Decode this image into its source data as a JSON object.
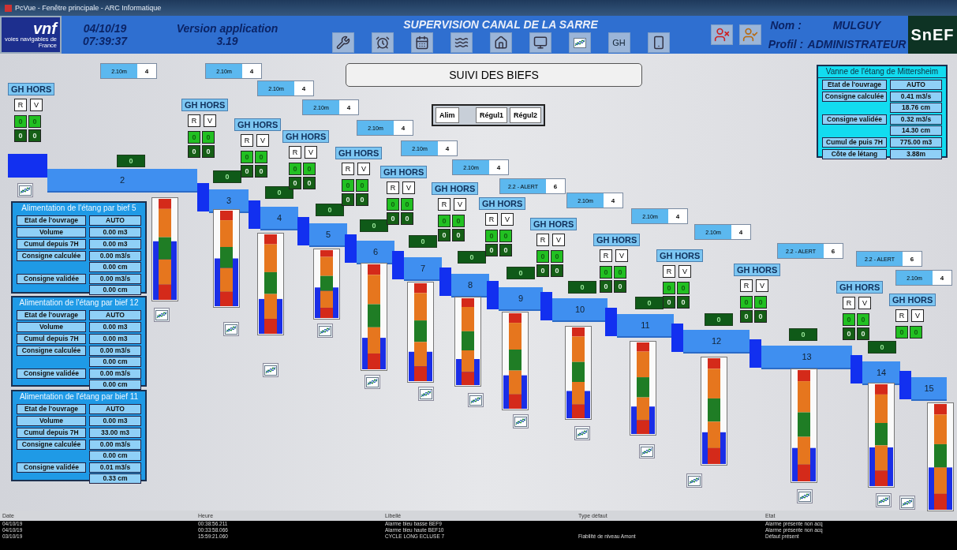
{
  "window": {
    "title": "PcVue - Fenêtre principale - ARC Informatique"
  },
  "header": {
    "logo_text": "vnf",
    "logo_subtitle": "voies navigables de France",
    "date": "04/10/19",
    "time": "07:39:37",
    "version_label": "Version application",
    "version": "3.19",
    "title": "SUPERVISION CANAL DE LA SARRE",
    "gh_button": "GH",
    "user_name_label": "Nom :",
    "user_name": "MULGUY",
    "profile_label": "Profil :",
    "profile": "ADMINISTRATEUR",
    "company_logo": "SnEF"
  },
  "synoptic": {
    "title": "SUIVI DES BIEFS",
    "mode_buttons": [
      "Alim",
      "Régul1",
      "Régul2"
    ],
    "level_indicators": [
      {
        "value": "2.10m",
        "count": "4"
      },
      {
        "value": "2.10m",
        "count": "4"
      },
      {
        "value": "2.10m",
        "count": "4"
      },
      {
        "value": "2.10m",
        "count": "4"
      },
      {
        "value": "2.10m",
        "count": "4"
      },
      {
        "value": "2.10m",
        "count": "4"
      },
      {
        "value": "2.10m",
        "count": "4"
      },
      {
        "value": "2.2 - ALERT",
        "count": "6"
      },
      {
        "value": "2.10m",
        "count": "4"
      },
      {
        "value": "2.10m",
        "count": "4"
      },
      {
        "value": "2.10m",
        "count": "4"
      },
      {
        "value": "2.2 - ALERT",
        "count": "6"
      },
      {
        "value": "2.2 - ALERT",
        "count": "6"
      },
      {
        "value": "2.10m",
        "count": "4"
      }
    ],
    "gate_panels": [
      {
        "status": "GH HORS",
        "buttons": [
          "R",
          "V"
        ],
        "counters": [
          "0",
          "0",
          "0",
          "0"
        ]
      },
      {
        "status": "GH HORS",
        "buttons": [
          "R",
          "V"
        ],
        "counters": [
          "0",
          "0",
          "0",
          "0"
        ]
      },
      {
        "status": "GH HORS",
        "buttons": [
          "R",
          "V"
        ],
        "counters": [
          "0",
          "0",
          "0",
          "0"
        ]
      },
      {
        "status": "GH HORS",
        "buttons": [
          "R",
          "V"
        ],
        "counters": [
          "0",
          "0",
          "0",
          "0"
        ]
      },
      {
        "status": "GH HORS",
        "buttons": [
          "R",
          "V"
        ],
        "counters": [
          "0",
          "0",
          "0",
          "0"
        ]
      },
      {
        "status": "GH HORS",
        "buttons": [
          "R",
          "V"
        ],
        "counters": [
          "0",
          "0",
          "0",
          "0"
        ]
      },
      {
        "status": "GH HORS",
        "buttons": [
          "R",
          "V"
        ],
        "counters": [
          "0",
          "0",
          "0",
          "0"
        ]
      },
      {
        "status": "GH HORS",
        "buttons": [
          "R",
          "V"
        ],
        "counters": [
          "0",
          "0",
          "0",
          "0"
        ]
      },
      {
        "status": "GH HORS",
        "buttons": [
          "R",
          "V"
        ],
        "counters": [
          "0",
          "0",
          "0",
          "0"
        ]
      },
      {
        "status": "GH HORS",
        "buttons": [
          "R",
          "V"
        ],
        "counters": [
          "0",
          "0",
          "0",
          "0"
        ]
      },
      {
        "status": "GH HORS",
        "buttons": [
          "R",
          "V"
        ],
        "counters": [
          "0",
          "0",
          "0",
          "0"
        ]
      },
      {
        "status": "GH HORS",
        "buttons": [
          "R",
          "V"
        ],
        "counters": [
          "0",
          "0",
          "0",
          "0"
        ]
      },
      {
        "status": "GH HORS",
        "buttons": [
          "R",
          "V"
        ],
        "counters": [
          "0",
          "0",
          "0",
          "0"
        ]
      },
      {
        "status": "GH HORS",
        "buttons": [
          "R",
          "V"
        ],
        "counters": [
          "0",
          "0"
        ]
      }
    ],
    "flow_values": [
      "0",
      "0",
      "0",
      "0",
      "0",
      "0",
      "0",
      "0",
      "0",
      "0",
      "0",
      "0",
      "0"
    ],
    "reaches": [
      {
        "label": "2",
        "level": 0.58
      },
      {
        "label": "3",
        "level": 0.5
      },
      {
        "label": "4",
        "level": 0.35
      },
      {
        "label": "5",
        "level": 0.45
      },
      {
        "label": "6",
        "level": 0.3
      },
      {
        "label": "7",
        "level": 0.3
      },
      {
        "label": "8",
        "level": 0.3
      },
      {
        "label": "9",
        "level": 0.35
      },
      {
        "label": "10",
        "level": 0.3
      },
      {
        "label": "11",
        "level": 0.3
      },
      {
        "label": "12",
        "level": 0.3
      },
      {
        "label": "13",
        "level": 0.3
      },
      {
        "label": "14",
        "level": 0.38
      },
      {
        "label": "15",
        "level": 0.4
      }
    ]
  },
  "feed_panels": [
    {
      "title": "Alimentation de l'étang par bief 5",
      "rows": [
        {
          "label": "Etat de l'ouvrage",
          "values": [
            "AUTO"
          ]
        },
        {
          "label": "Volume",
          "values": [
            "0.00 m3"
          ]
        },
        {
          "label": "Cumul depuis 7H",
          "values": [
            "0.00 m3"
          ]
        },
        {
          "label": "Consigne calculée",
          "values": [
            "0.00 m3/s",
            "0.00 cm"
          ]
        },
        {
          "label": "Consigne validée",
          "values": [
            "0.00 m3/s",
            "0.00 cm"
          ]
        }
      ]
    },
    {
      "title": "Alimentation de l'étang par bief 12",
      "rows": [
        {
          "label": "Etat de l'ouvrage",
          "values": [
            "AUTO"
          ]
        },
        {
          "label": "Volume",
          "values": [
            "0.00 m3"
          ]
        },
        {
          "label": "Cumul depuis 7H",
          "values": [
            "0.00 m3"
          ]
        },
        {
          "label": "Consigne calculée",
          "values": [
            "0.00 m3/s",
            "0.00 cm"
          ]
        },
        {
          "label": "Consigne validée",
          "values": [
            "0.00 m3/s",
            "0.00 cm"
          ]
        }
      ]
    },
    {
      "title": "Alimentation de l'étang par bief 11",
      "rows": [
        {
          "label": "Etat de l'ouvrage",
          "values": [
            "AUTO"
          ]
        },
        {
          "label": "Volume",
          "values": [
            "0.00 m3"
          ]
        },
        {
          "label": "Cumul depuis 7H",
          "values": [
            "33.00 m3"
          ]
        },
        {
          "label": "Consigne calculée",
          "values": [
            "0.00 m3/s",
            "0.00 cm"
          ]
        },
        {
          "label": "Consigne validée",
          "values": [
            "0.01 m3/s",
            "0.33 cm"
          ]
        }
      ]
    }
  ],
  "gate_panel": {
    "title": "Vanne de l'étang de Mittersheim",
    "rows": [
      {
        "label": "Etat de l'ouvrage",
        "values": [
          "AUTO"
        ]
      },
      {
        "label": "Consigne calculée",
        "values": [
          "0.41 m3/s",
          "18.76 cm"
        ]
      },
      {
        "label": "Consigne validée",
        "values": [
          "0.32 m3/s",
          "14.30 cm"
        ]
      },
      {
        "label": "Cumul de puis 7H",
        "values": [
          "775.00 m3"
        ]
      },
      {
        "label": "Côte de létang",
        "values": [
          "3.88m"
        ]
      }
    ]
  },
  "alarms": {
    "columns": [
      "Date",
      "Heure",
      "Libellé",
      "Type défaut",
      "Etat"
    ],
    "rows": [
      [
        "04/10/19",
        "00:38:56.211",
        "Alarme bleu basse BEF9",
        "",
        "Alarme présente non acq"
      ],
      [
        "04/10/19",
        "00:33:58.066",
        "Alarme bleu haute BEF10",
        "",
        "Alarme présente non acq"
      ],
      [
        "03/10/19",
        "15:59:21.060",
        "CYCLE LONG ECLUSE 7",
        "Fiabilité de niveau Amont",
        "Défaut présent"
      ]
    ]
  }
}
